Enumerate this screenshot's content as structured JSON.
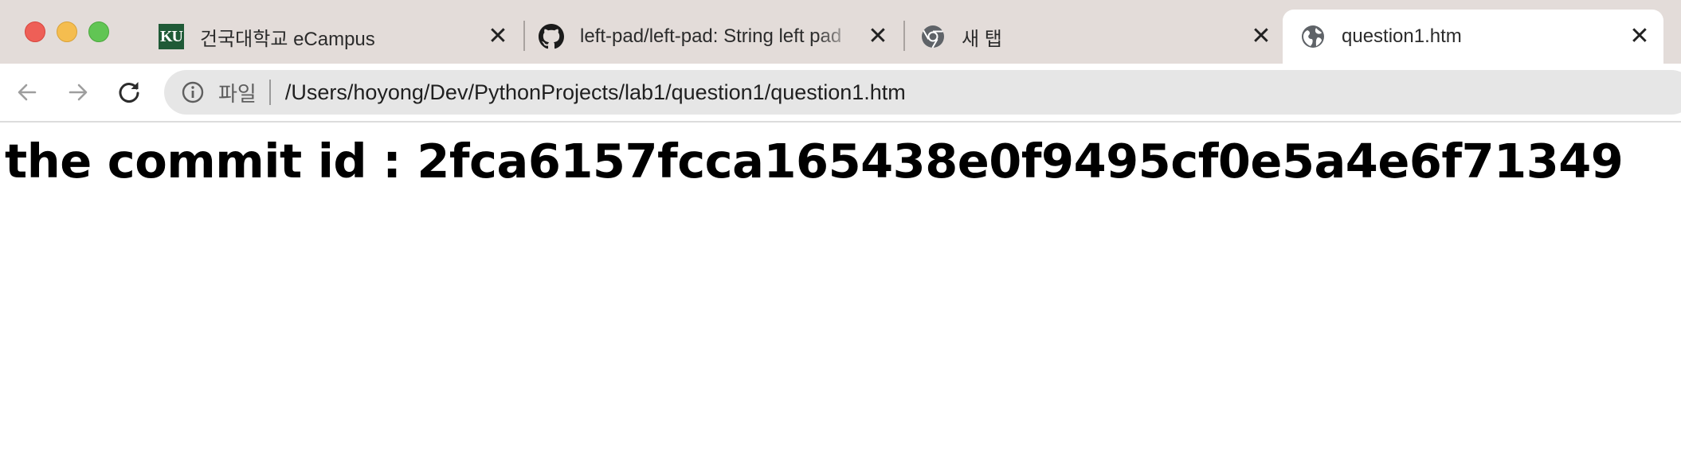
{
  "browser": {
    "tabs": [
      {
        "favicon": "ku-logo-icon",
        "favicon_text": "KU",
        "title": "건국대학교 eCampus",
        "close": "✕",
        "active": false
      },
      {
        "favicon": "github-icon",
        "title": "left-pad/left-pad: String left pad",
        "close": "✕",
        "active": false
      },
      {
        "favicon": "chrome-icon",
        "title": "새 탭",
        "close": "✕",
        "active": false
      },
      {
        "favicon": "globe-icon",
        "title": "question1.htm",
        "close": "✕",
        "active": true
      }
    ],
    "toolbar": {
      "back_icon": "arrow-left-icon",
      "forward_icon": "arrow-right-icon",
      "reload_icon": "reload-icon",
      "info_icon": "info-icon",
      "scheme_label": "파일",
      "url": "/Users/hoyong/Dev/PythonProjects/lab1/question1/question1.htm"
    },
    "colors": {
      "tabstrip_bg": "#e3dcd9",
      "omnibox_bg": "#e6e6e6",
      "close_red": "#ee5f57",
      "minimize_yellow": "#f5bd4f",
      "zoom_green": "#61c554",
      "ku_green": "#1f5a37"
    }
  },
  "page": {
    "heading": "the commit id : 2fca6157fcca165438e0f9495cf0e5a4e6f71349"
  }
}
